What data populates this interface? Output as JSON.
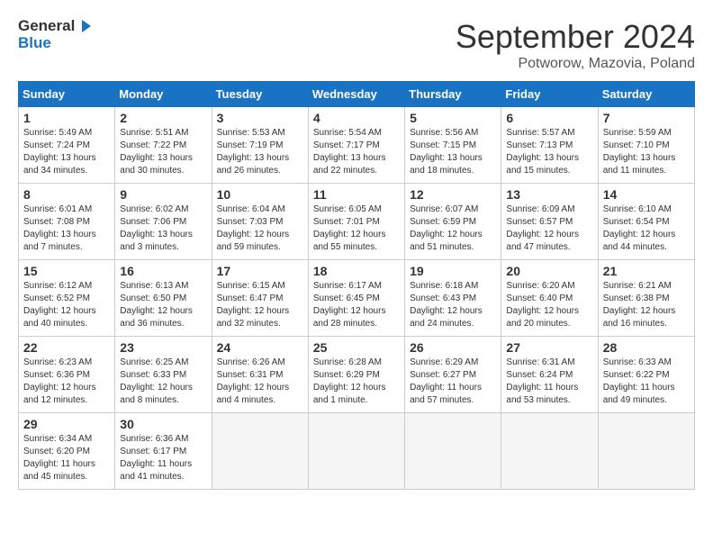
{
  "header": {
    "logo_line1": "General",
    "logo_line2": "Blue",
    "month_year": "September 2024",
    "location": "Potworow, Mazovia, Poland"
  },
  "weekdays": [
    "Sunday",
    "Monday",
    "Tuesday",
    "Wednesday",
    "Thursday",
    "Friday",
    "Saturday"
  ],
  "weeks": [
    [
      {
        "day": "1",
        "info": "Sunrise: 5:49 AM\nSunset: 7:24 PM\nDaylight: 13 hours\nand 34 minutes."
      },
      {
        "day": "2",
        "info": "Sunrise: 5:51 AM\nSunset: 7:22 PM\nDaylight: 13 hours\nand 30 minutes."
      },
      {
        "day": "3",
        "info": "Sunrise: 5:53 AM\nSunset: 7:19 PM\nDaylight: 13 hours\nand 26 minutes."
      },
      {
        "day": "4",
        "info": "Sunrise: 5:54 AM\nSunset: 7:17 PM\nDaylight: 13 hours\nand 22 minutes."
      },
      {
        "day": "5",
        "info": "Sunrise: 5:56 AM\nSunset: 7:15 PM\nDaylight: 13 hours\nand 18 minutes."
      },
      {
        "day": "6",
        "info": "Sunrise: 5:57 AM\nSunset: 7:13 PM\nDaylight: 13 hours\nand 15 minutes."
      },
      {
        "day": "7",
        "info": "Sunrise: 5:59 AM\nSunset: 7:10 PM\nDaylight: 13 hours\nand 11 minutes."
      }
    ],
    [
      {
        "day": "8",
        "info": "Sunrise: 6:01 AM\nSunset: 7:08 PM\nDaylight: 13 hours\nand 7 minutes."
      },
      {
        "day": "9",
        "info": "Sunrise: 6:02 AM\nSunset: 7:06 PM\nDaylight: 13 hours\nand 3 minutes."
      },
      {
        "day": "10",
        "info": "Sunrise: 6:04 AM\nSunset: 7:03 PM\nDaylight: 12 hours\nand 59 minutes."
      },
      {
        "day": "11",
        "info": "Sunrise: 6:05 AM\nSunset: 7:01 PM\nDaylight: 12 hours\nand 55 minutes."
      },
      {
        "day": "12",
        "info": "Sunrise: 6:07 AM\nSunset: 6:59 PM\nDaylight: 12 hours\nand 51 minutes."
      },
      {
        "day": "13",
        "info": "Sunrise: 6:09 AM\nSunset: 6:57 PM\nDaylight: 12 hours\nand 47 minutes."
      },
      {
        "day": "14",
        "info": "Sunrise: 6:10 AM\nSunset: 6:54 PM\nDaylight: 12 hours\nand 44 minutes."
      }
    ],
    [
      {
        "day": "15",
        "info": "Sunrise: 6:12 AM\nSunset: 6:52 PM\nDaylight: 12 hours\nand 40 minutes."
      },
      {
        "day": "16",
        "info": "Sunrise: 6:13 AM\nSunset: 6:50 PM\nDaylight: 12 hours\nand 36 minutes."
      },
      {
        "day": "17",
        "info": "Sunrise: 6:15 AM\nSunset: 6:47 PM\nDaylight: 12 hours\nand 32 minutes."
      },
      {
        "day": "18",
        "info": "Sunrise: 6:17 AM\nSunset: 6:45 PM\nDaylight: 12 hours\nand 28 minutes."
      },
      {
        "day": "19",
        "info": "Sunrise: 6:18 AM\nSunset: 6:43 PM\nDaylight: 12 hours\nand 24 minutes."
      },
      {
        "day": "20",
        "info": "Sunrise: 6:20 AM\nSunset: 6:40 PM\nDaylight: 12 hours\nand 20 minutes."
      },
      {
        "day": "21",
        "info": "Sunrise: 6:21 AM\nSunset: 6:38 PM\nDaylight: 12 hours\nand 16 minutes."
      }
    ],
    [
      {
        "day": "22",
        "info": "Sunrise: 6:23 AM\nSunset: 6:36 PM\nDaylight: 12 hours\nand 12 minutes."
      },
      {
        "day": "23",
        "info": "Sunrise: 6:25 AM\nSunset: 6:33 PM\nDaylight: 12 hours\nand 8 minutes."
      },
      {
        "day": "24",
        "info": "Sunrise: 6:26 AM\nSunset: 6:31 PM\nDaylight: 12 hours\nand 4 minutes."
      },
      {
        "day": "25",
        "info": "Sunrise: 6:28 AM\nSunset: 6:29 PM\nDaylight: 12 hours\nand 1 minute."
      },
      {
        "day": "26",
        "info": "Sunrise: 6:29 AM\nSunset: 6:27 PM\nDaylight: 11 hours\nand 57 minutes."
      },
      {
        "day": "27",
        "info": "Sunrise: 6:31 AM\nSunset: 6:24 PM\nDaylight: 11 hours\nand 53 minutes."
      },
      {
        "day": "28",
        "info": "Sunrise: 6:33 AM\nSunset: 6:22 PM\nDaylight: 11 hours\nand 49 minutes."
      }
    ],
    [
      {
        "day": "29",
        "info": "Sunrise: 6:34 AM\nSunset: 6:20 PM\nDaylight: 11 hours\nand 45 minutes."
      },
      {
        "day": "30",
        "info": "Sunrise: 6:36 AM\nSunset: 6:17 PM\nDaylight: 11 hours\nand 41 minutes."
      },
      {
        "day": "",
        "info": ""
      },
      {
        "day": "",
        "info": ""
      },
      {
        "day": "",
        "info": ""
      },
      {
        "day": "",
        "info": ""
      },
      {
        "day": "",
        "info": ""
      }
    ]
  ]
}
